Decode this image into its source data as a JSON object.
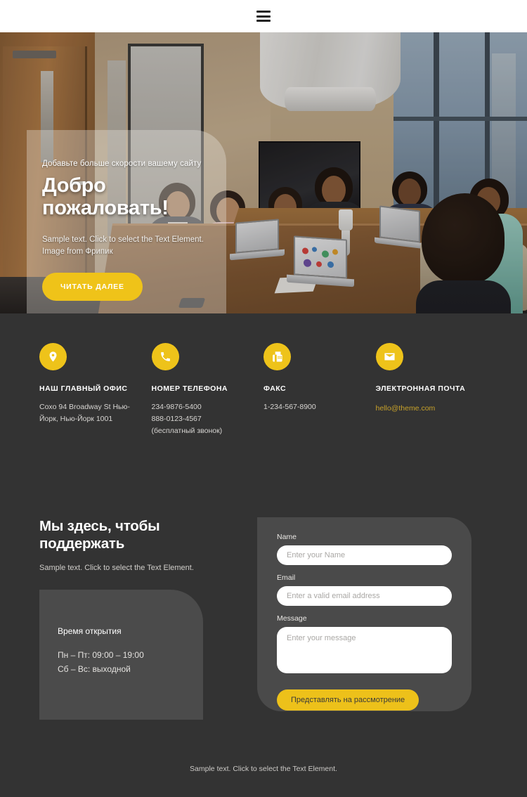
{
  "header": {
    "menu_icon": "hamburger-menu-icon"
  },
  "hero": {
    "kicker": "Добавьте больше скорости вашему сайту",
    "title": "Добро пожаловать!",
    "subtext": "Sample text. Click to select the Text Element. Image from Фрипик",
    "cta_label": "ЧИТАТЬ ДАЛЕЕ",
    "accent_color": "#efc319"
  },
  "contacts": [
    {
      "icon": "location-pin-icon",
      "title": "НАШ ГЛАВНЫЙ ОФИС",
      "lines": [
        "Coxo 94 Broadway St Нью-Йорк, Нью-Йорк 1001"
      ],
      "link": ""
    },
    {
      "icon": "phone-icon",
      "title": "НОМЕР ТЕЛЕФОНА",
      "lines": [
        "234-9876-5400",
        "888-0123-4567",
        "(бесплатный звонок)"
      ],
      "link": ""
    },
    {
      "icon": "fax-icon",
      "title": "ФАКС",
      "lines": [
        "1-234-567-8900"
      ],
      "link": ""
    },
    {
      "icon": "envelope-icon",
      "title": "ЭЛЕКТРОННАЯ ПОЧТА",
      "lines": [],
      "link": "hello@theme.com"
    }
  ],
  "support": {
    "title": "Мы здесь, чтобы поддержать",
    "text": "Sample text. Click to select the Text Element.",
    "hours": {
      "title": "Время открытия",
      "weekday": "Пн – Пт: 09:00 – 19:00",
      "weekend": "Сб – Вс: выходной"
    }
  },
  "form": {
    "name_label": "Name",
    "name_placeholder": "Enter your Name",
    "name_value": "",
    "email_label": "Email",
    "email_placeholder": "Enter a valid email address",
    "email_value": "",
    "message_label": "Message",
    "message_placeholder": "Enter your message",
    "message_value": "",
    "submit_label": "Представлять на рассмотрение"
  },
  "footer": {
    "text": "Sample text. Click to select the Text Element."
  }
}
